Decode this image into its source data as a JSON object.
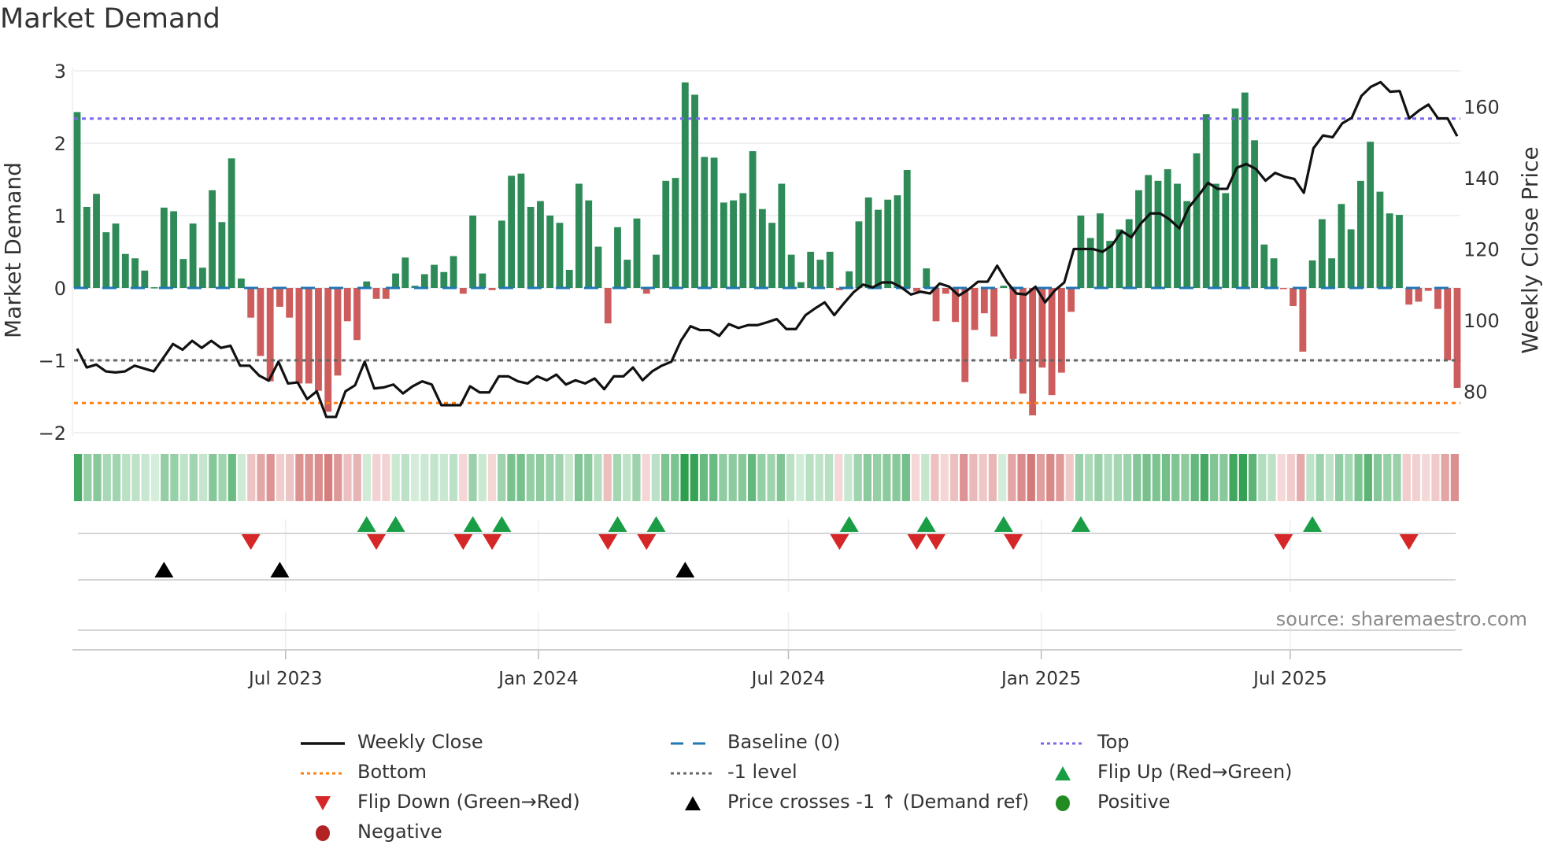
{
  "title": "Market Demand",
  "source": "source: sharemaestro.com",
  "colors": {
    "positive_bar": "#2e8b57",
    "negative_bar": "#cd5c5c",
    "baseline": "#1f77b4",
    "top": "#7b68ee",
    "bottom": "#ff7f0e",
    "minus1": "#666666",
    "flip_up": "#1a9e45",
    "flip_down": "#d62728",
    "cross": "#000000",
    "positive_dot": "#228b22",
    "negative_dot": "#b22222"
  },
  "legend": [
    {
      "label": "Weekly Close",
      "icon": "solid-line",
      "color": "#111111"
    },
    {
      "label": "Baseline (0)",
      "icon": "dashed-line",
      "color": "#1f77b4"
    },
    {
      "label": "Top",
      "icon": "dotted-line",
      "color": "#7b68ee"
    },
    {
      "label": "Bottom",
      "icon": "dotted-line",
      "color": "#ff7f0e"
    },
    {
      "label": "-1 level",
      "icon": "dotted-line",
      "color": "#666666"
    },
    {
      "label": "Flip Up (Red→Green)",
      "icon": "triangle-up",
      "color": "#1a9e45"
    },
    {
      "label": "Flip Down (Green→Red)",
      "icon": "triangle-down",
      "color": "#d62728"
    },
    {
      "label": "Price crosses -1 ↑ (Demand ref)",
      "icon": "triangle-up",
      "color": "#000000"
    },
    {
      "label": "Positive",
      "icon": "dot",
      "color": "#228b22"
    },
    {
      "label": "Negative",
      "icon": "dot",
      "color": "#b22222"
    }
  ],
  "chart_data": {
    "type": "bar",
    "title": "Market Demand",
    "ylabel": "Market Demand",
    "y2label": "Weekly Close Price",
    "ylim": [
      -2,
      3
    ],
    "y2lim": [
      72,
      170
    ],
    "yticks": [
      "3",
      "2",
      "1",
      "0",
      "−1",
      "−2"
    ],
    "ytick_values": [
      3,
      2,
      1,
      0,
      -1,
      -2
    ],
    "y2ticks": [
      "160",
      "140",
      "120",
      "100",
      "80"
    ],
    "y2tick_values": [
      160,
      140,
      120,
      100,
      80
    ],
    "x_range": [
      "2023-02",
      "2025-10"
    ],
    "xticks": [
      {
        "label": "Jul 2023",
        "week": 21.6
      },
      {
        "label": "Jan 2024",
        "week": 47.8
      },
      {
        "label": "Jul 2024",
        "week": 73.7
      },
      {
        "label": "Jan 2025",
        "week": 99.9
      },
      {
        "label": "Jul 2025",
        "week": 125.7
      }
    ],
    "levels": {
      "top": 2.34,
      "bottom": -1.59,
      "minus1": -1,
      "baseline": 0
    },
    "series": [
      {
        "name": "Market Demand",
        "values": [
          2.43,
          1.12,
          1.3,
          0.77,
          0.89,
          0.47,
          0.41,
          0.24,
          0.01,
          1.11,
          1.06,
          0.4,
          0.89,
          0.28,
          1.35,
          0.91,
          1.79,
          0.13,
          -0.41,
          -0.94,
          -1.29,
          -0.26,
          -0.41,
          -1.32,
          -1.32,
          -1.42,
          -1.71,
          -1.21,
          -0.46,
          -0.72,
          0.09,
          -0.15,
          -0.15,
          0.2,
          0.42,
          0.03,
          0.19,
          0.32,
          0.22,
          0.44,
          -0.08,
          1.0,
          0.2,
          -0.03,
          0.93,
          1.55,
          1.58,
          1.12,
          1.2,
          1.0,
          0.9,
          0.25,
          1.44,
          1.21,
          0.57,
          -0.49,
          0.84,
          0.39,
          0.96,
          -0.08,
          0.46,
          1.48,
          1.52,
          2.84,
          2.67,
          1.81,
          1.8,
          1.18,
          1.21,
          1.31,
          1.89,
          1.09,
          0.9,
          1.44,
          0.46,
          0.08,
          0.5,
          0.39,
          0.5,
          -0.03,
          0.23,
          0.92,
          1.25,
          1.08,
          1.22,
          1.28,
          1.63,
          -0.05,
          0.27,
          -0.46,
          -0.08,
          -0.47,
          -1.3,
          -0.58,
          -0.35,
          -0.67,
          0.03,
          -0.98,
          -1.46,
          -1.76,
          -1.1,
          -1.48,
          -1.17,
          -0.33,
          1.0,
          0.69,
          1.03,
          0.65,
          0.81,
          0.95,
          1.35,
          1.56,
          1.48,
          1.64,
          1.44,
          1.2,
          1.86,
          2.4,
          1.44,
          1.31,
          2.48,
          2.7,
          2.04,
          0.6,
          0.41,
          -0.01,
          -0.25,
          -0.88,
          0.38,
          0.95,
          0.41,
          1.16,
          0.81,
          1.48,
          2.02,
          1.33,
          1.03,
          1.01,
          -0.23,
          -0.19,
          -0.04,
          -0.29,
          -1.0,
          -1.38
        ]
      },
      {
        "name": "Weekly Close",
        "values": [
          92,
          86.7,
          87.5,
          85.6,
          85.3,
          85.6,
          87.2,
          86.4,
          85.6,
          89.4,
          93.3,
          91.7,
          94.2,
          92.2,
          94.2,
          92.2,
          92.8,
          87.2,
          87.2,
          84.4,
          83,
          88.3,
          82.2,
          82.5,
          77.8,
          80,
          72.8,
          72.8,
          80,
          81.7,
          88.3,
          80.8,
          81.1,
          81.9,
          79.4,
          81.4,
          82.8,
          81.9,
          76.1,
          76.1,
          76.1,
          81.4,
          79.7,
          79.7,
          84.2,
          84.2,
          82.8,
          82.2,
          84.2,
          83.1,
          84.7,
          81.9,
          83.1,
          82.2,
          83.6,
          80.6,
          84.2,
          84.2,
          86.7,
          83.1,
          85.6,
          87.2,
          88.3,
          94.2,
          98.3,
          97.2,
          97.2,
          95.6,
          98.9,
          97.8,
          98.6,
          98.6,
          99.4,
          100.3,
          97.5,
          97.5,
          101.4,
          103.3,
          105,
          101.4,
          104.7,
          107.8,
          110,
          109.2,
          110.6,
          110.6,
          109.2,
          107.2,
          108,
          107.5,
          110.3,
          109.4,
          106.9,
          108.6,
          110.8,
          110.8,
          115.3,
          110.8,
          107.5,
          107.2,
          109.4,
          105,
          108.3,
          110.6,
          120,
          120,
          120,
          119.2,
          121.1,
          125,
          123.3,
          127.2,
          130,
          130,
          128.3,
          125.8,
          131.7,
          135,
          138.6,
          136.9,
          136.9,
          142.8,
          143.9,
          142.5,
          139.2,
          141.4,
          140.3,
          139.7,
          135.8,
          148.3,
          151.9,
          151.4,
          155.3,
          156.9,
          163,
          165.6,
          166.9,
          164.2,
          164.4,
          156.7,
          158.9,
          160.6,
          156.7,
          156.7,
          151.7
        ]
      }
    ],
    "price_cross_weeks": [
      9,
      21,
      63
    ],
    "grid": true,
    "legend_position": "bottom"
  }
}
